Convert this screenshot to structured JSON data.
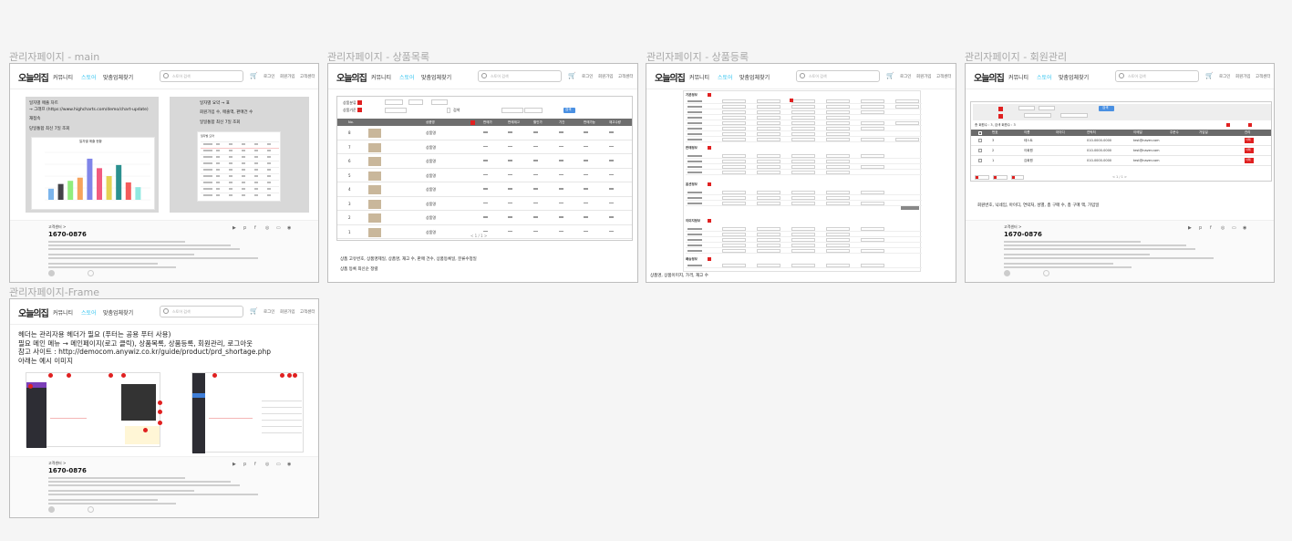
{
  "frames": [
    {
      "label": "관리자페이지 - main"
    },
    {
      "label": "관리자페이지 - 상품목록"
    },
    {
      "label": "관리자페이지 - 상품등록"
    },
    {
      "label": "관리자페이지 - 회원관리"
    },
    {
      "label": "관리자페이지-Frame"
    }
  ],
  "header": {
    "logo": "오늘의집",
    "nav": [
      "커뮤니티",
      "스토어",
      "맞춤업체찾기"
    ],
    "search_placeholder": "스토어 검색",
    "links": [
      "로그인",
      "회원가입",
      "고객센터"
    ]
  },
  "footer": {
    "company": "고객센터 >",
    "phone": "1670-0876"
  },
  "main": {
    "left_lines": [
      "일자별 매출 차트",
      "→ 그래프 (https://www.highcharts.com/demo/chart-update)",
      "재접속",
      "당일통합 최신 7일 조회"
    ],
    "right_lines": [
      "일자별 요약 → 표",
      "회원가입 수, 매출액, 판매건 수",
      "일일통합 최신 7일 조회"
    ],
    "chart_title": "일자별 매출 현황",
    "table_title": "일자별 요약"
  },
  "chart_data": {
    "type": "bar",
    "categories": [
      "1",
      "2",
      "3",
      "4",
      "5",
      "6",
      "7",
      "8",
      "9",
      "10"
    ],
    "values": [
      14,
      20,
      24,
      28,
      52,
      40,
      30,
      44,
      22,
      16
    ],
    "colors": [
      "#7cb5ec",
      "#434348",
      "#90ed7d",
      "#f7a35c",
      "#8085e9",
      "#f15c80",
      "#e4d354",
      "#2b908f",
      "#f45b5b",
      "#91e8e1"
    ]
  },
  "list": {
    "filters": [
      "상품분류",
      "상품기준",
      "검색"
    ],
    "columns": [
      "No.",
      "상품명",
      "판매가",
      "판매재고",
      "할인가",
      "기간",
      "판매가능",
      "재고수량"
    ],
    "rows": [
      {
        "no": "8",
        "name": "상품명"
      },
      {
        "no": "7",
        "name": "상품명"
      },
      {
        "no": "6",
        "name": "상품명"
      },
      {
        "no": "5",
        "name": "상품명"
      },
      {
        "no": "4",
        "name": "상품명"
      },
      {
        "no": "3",
        "name": "상품명"
      },
      {
        "no": "2",
        "name": "상품명"
      },
      {
        "no": "1",
        "name": "상품명"
      }
    ],
    "search_btn": "검색",
    "pagination": "< 1 / 1 >",
    "notes": [
      "상품 고유번호, 상품명제일, 상품명, 재고 수, 판매 건수, 상품등록일, 분류수정일",
      "상품 등록 최신순 정렬"
    ]
  },
  "register": {
    "sections": [
      "기본정보",
      "판매정보",
      "옵션정보",
      "이미지정보",
      "배송정보"
    ],
    "note": "상품명, 상품이미지, 가격, 재고 수"
  },
  "members": {
    "columns": [
      "번호",
      "이름",
      "아이디",
      "연락처",
      "이메일",
      "주문수",
      "가입일",
      "관리"
    ],
    "rows": [
      {
        "no": "3",
        "name": "테스트",
        "phone": "010-0000-0000",
        "email": "test@naver.com"
      },
      {
        "no": "2",
        "name": "이회원",
        "phone": "010-0000-0000",
        "email": "test@naver.com"
      },
      {
        "no": "1",
        "name": "김회원",
        "phone": "010-0000-0000",
        "email": "test@naver.com"
      }
    ],
    "search_btn": "검색",
    "count": "총 회원수 : 3, 검색 회원수 : 3",
    "delete": "삭제",
    "note": "회원번호, 닉네임, 아이디, 연락처, 성별, 총 구매 수, 총 구매 액, 가입일"
  },
  "frame5": {
    "lines": [
      "헤더는 관리자용 헤더가 필요 (푸터는 공용 푸터 사용)",
      "필요 메인 메뉴 → 메인페이지(로고 클릭), 상품목록, 상품등록, 회원관리, 로그아웃",
      "참고 사이트 : http://democom.anywiz.co.kr/guide/product/prd_shortage.php",
      "아래는 예시 이미지"
    ]
  },
  "colors": {
    "accent": "#35c5f0",
    "red": "#e02020",
    "blue": "#4a90e2"
  }
}
